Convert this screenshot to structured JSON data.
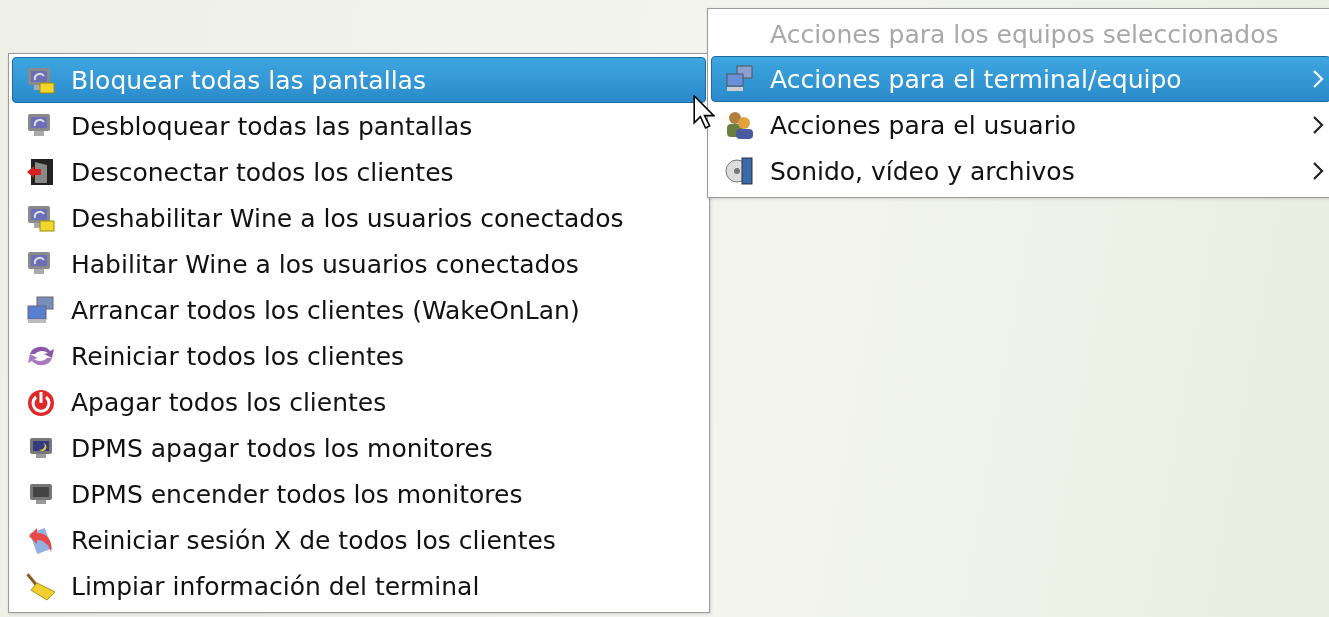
{
  "main_menu": {
    "items": [
      {
        "label": "Bloquear todas las pantallas",
        "selected": true
      },
      {
        "label": "Desbloquear todas las pantallas",
        "selected": false
      },
      {
        "label": "Desconectar todos los clientes",
        "selected": false
      },
      {
        "label": "Deshabilitar Wine a los usuarios conectados",
        "selected": false
      },
      {
        "label": "Habilitar Wine a los usuarios conectados",
        "selected": false
      },
      {
        "label": "Arrancar todos los clientes (WakeOnLan)",
        "selected": false
      },
      {
        "label": "Reiniciar todos los clientes",
        "selected": false
      },
      {
        "label": "Apagar todos los clientes",
        "selected": false
      },
      {
        "label": "DPMS apagar todos los monitores",
        "selected": false
      },
      {
        "label": "DPMS encender todos los monitores",
        "selected": false
      },
      {
        "label": "Reiniciar sesión X de todos los clientes",
        "selected": false
      },
      {
        "label": "Limpiar información del terminal",
        "selected": false
      }
    ]
  },
  "context_menu": {
    "items": [
      {
        "kind": "header",
        "label": "Acciones para los equipos seleccionados",
        "disabled": true,
        "selected": false
      },
      {
        "kind": "submenu",
        "label": "Acciones para el terminal/equipo",
        "disabled": false,
        "selected": true
      },
      {
        "kind": "submenu",
        "label": "Acciones para el usuario",
        "disabled": false,
        "selected": false
      },
      {
        "kind": "submenu",
        "label": "Sonido, vídeo y archivos",
        "disabled": false,
        "selected": false
      }
    ]
  }
}
